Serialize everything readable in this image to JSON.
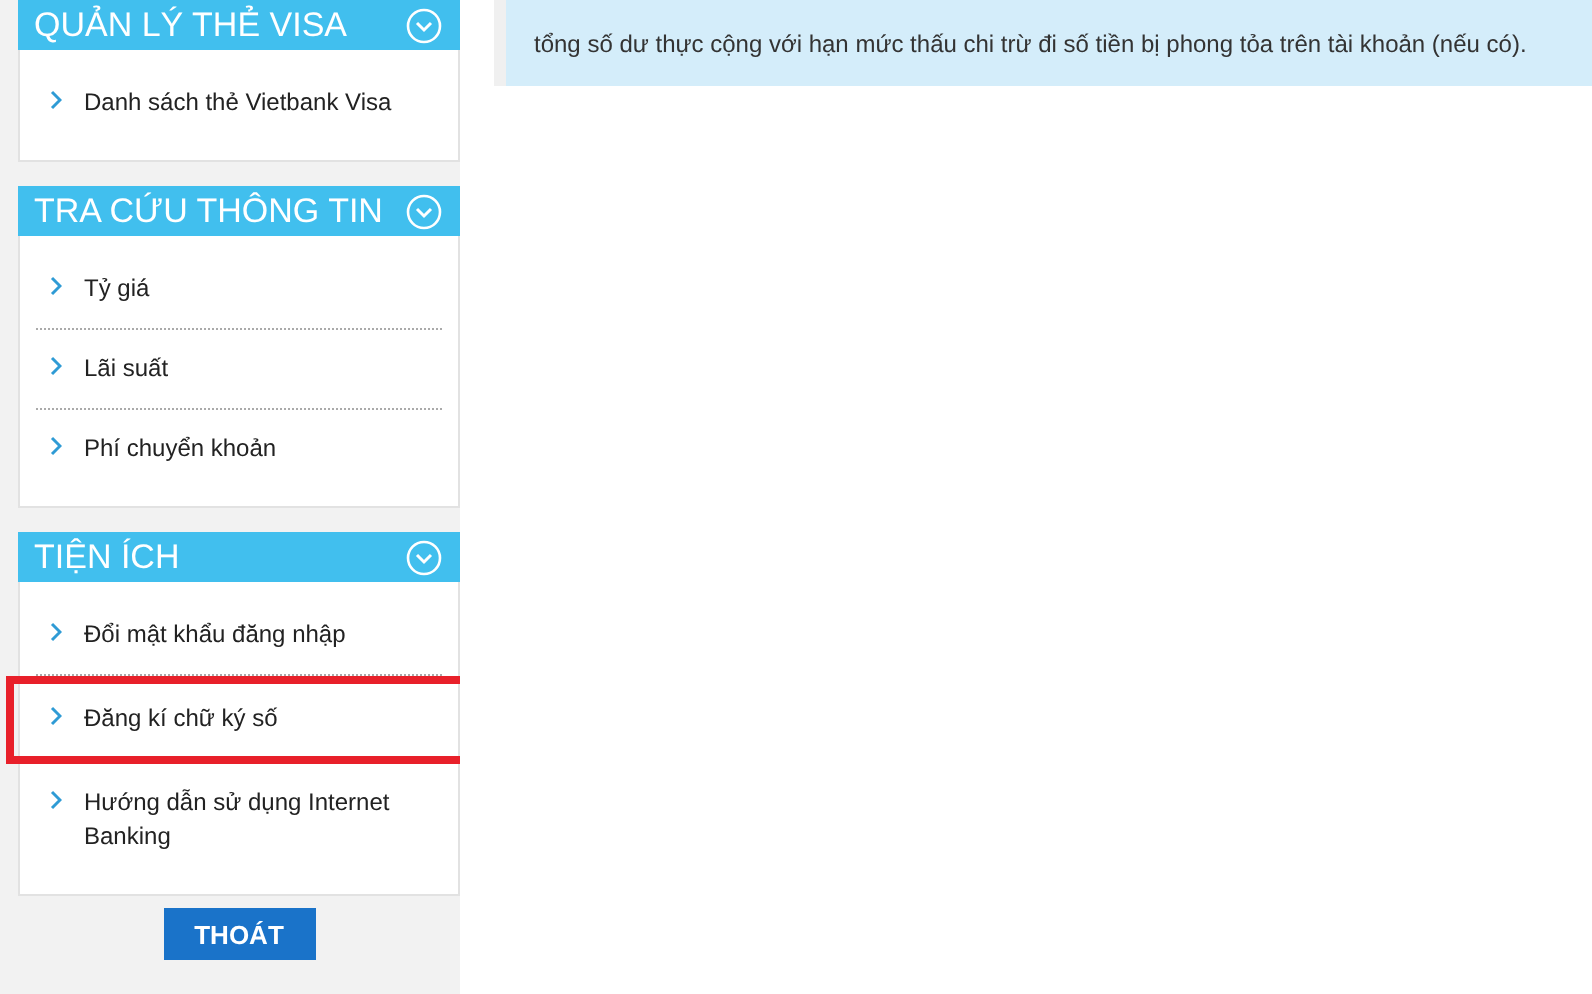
{
  "sidebar": {
    "sections": [
      {
        "title": "QUẢN LÝ THẺ VISA",
        "expanded": true,
        "items": [
          {
            "label": "Danh sách thẻ Vietbank Visa",
            "highlighted": false
          }
        ]
      },
      {
        "title": "TRA CỨU THÔNG TIN",
        "expanded": true,
        "items": [
          {
            "label": "Tỷ giá",
            "highlighted": false
          },
          {
            "label": "Lãi suất",
            "highlighted": false
          },
          {
            "label": "Phí chuyển khoản",
            "highlighted": false
          }
        ]
      },
      {
        "title": "TIỆN ÍCH",
        "expanded": true,
        "items": [
          {
            "label": "Đổi mật khẩu đăng nhập",
            "highlighted": false
          },
          {
            "label": "Đăng kí chữ ký số",
            "highlighted": true
          },
          {
            "label": "Hướng dẫn sử dụng Internet Banking",
            "highlighted": false
          }
        ]
      }
    ],
    "logout_button": "THOÁT"
  },
  "note": {
    "lines": [
      "tổng số dư thực cộng với hạn mức thấu chi trừ đi số tiền bị phong tỏa trên tài khoản (nếu có)."
    ]
  }
}
